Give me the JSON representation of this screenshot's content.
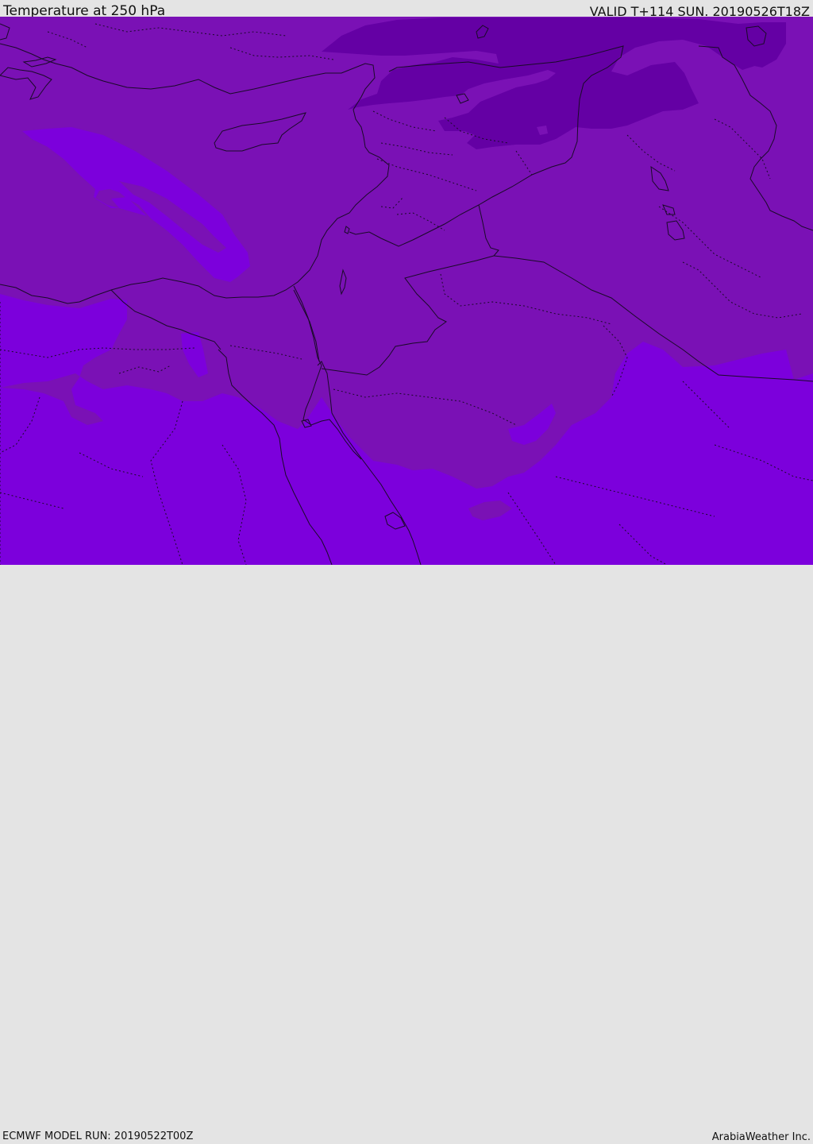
{
  "header": {
    "title": "Temperature at 250 hPa",
    "valid": "VALID T+114 SUN. 20190526T18Z"
  },
  "footer": {
    "model_run": "ECMWF MODEL RUN: 20190522T00Z",
    "credit": "ArabiaWeather Inc."
  },
  "map": {
    "field": "temperature-250hPa",
    "colors": {
      "warm_band": "#7a11b5",
      "cold_band": "#6400a4",
      "warmer_band": "#7c00dc",
      "border": "#1a0a28"
    }
  }
}
